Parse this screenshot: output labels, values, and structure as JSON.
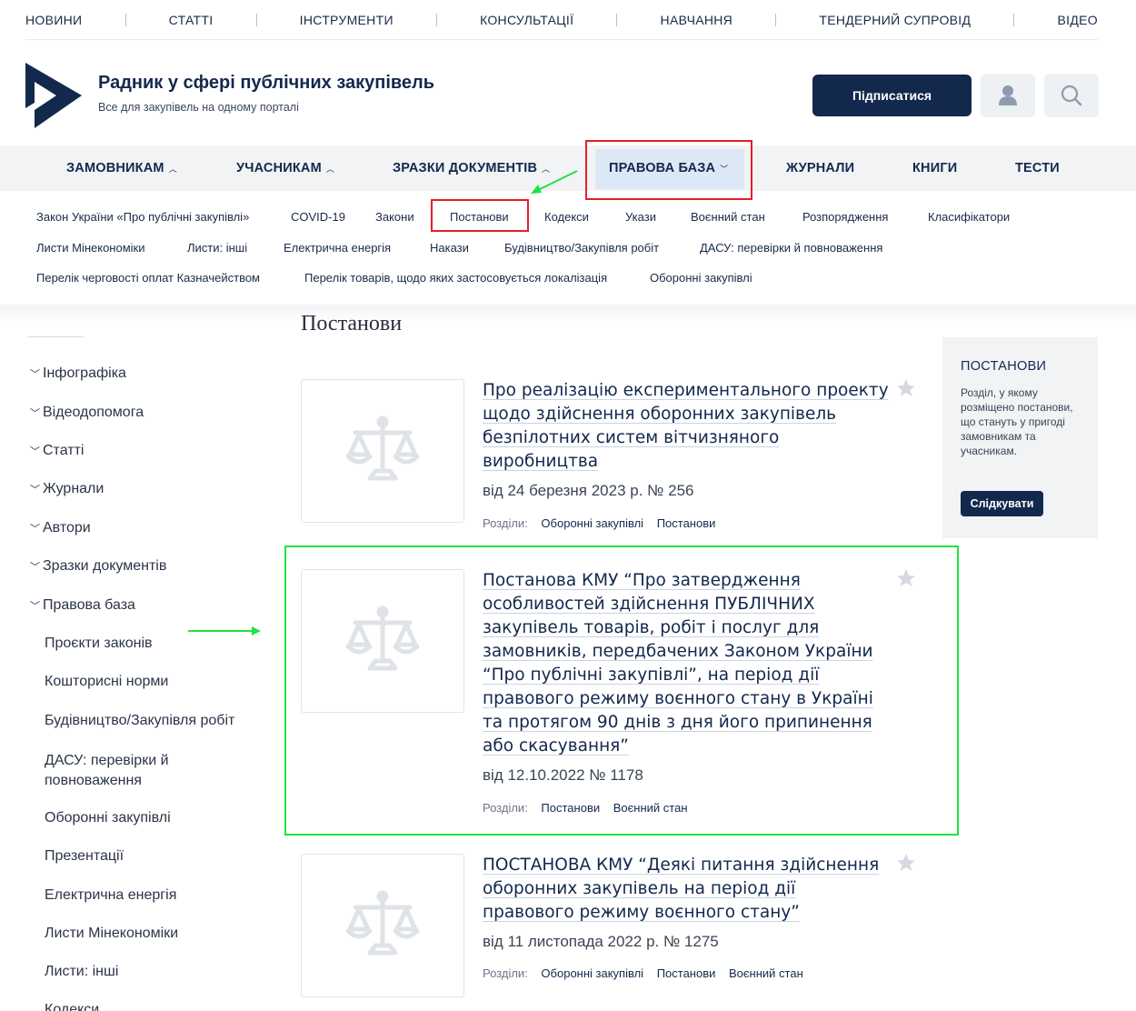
{
  "topnav": [
    "НОВИНИ",
    "СТАТТІ",
    "ІНСТРУМЕНТИ",
    "КОНСУЛЬТАЦІЇ",
    "НАВЧАННЯ",
    "ТЕНДЕРНИЙ СУПРОВІД",
    "ВІДЕО"
  ],
  "header": {
    "title": "Радник у сфері публічних закупівель",
    "subtitle": "Все для закупівель на одному порталі",
    "subscribe_label": "Підписатися",
    "user_icon": "user-icon",
    "search_icon": "search-icon"
  },
  "mainnav": {
    "items": [
      "ЗАМОВНИКАМ",
      "УЧАСНИКАМ",
      "ЗРАЗКИ ДОКУМЕНТІВ",
      "ПРАВОВА БАЗА",
      "ЖУРНАЛИ",
      "КНИГИ",
      "ТЕСТИ"
    ],
    "caret_up": "^",
    "caret_down": "v"
  },
  "subnav": {
    "items": [
      "Закон України «Про публічні закупівлі»",
      "COVID-19",
      "Закони",
      "Постанови",
      "Кодекси",
      "Укази",
      "Воєнний стан",
      "Розпорядження",
      "Класифікатори",
      "Листи Мінекономіки",
      "Листи: інші",
      "Електрична енергія",
      "Накази",
      "Будівництво/Закупівля робіт",
      "ДАСУ: перевірки й повноваження",
      "Перелік черговості оплат Казначейством",
      "Перелік товарів, щодо яких застосовується локалізація",
      "Оборонні закупівлі"
    ]
  },
  "sidebar": {
    "items": [
      "Інфографіка",
      "Відеодопомога",
      "Статті",
      "Журнали",
      "Автори",
      "Зразки документів",
      "Правова база"
    ],
    "subitems": [
      "Проєкти законів",
      "Кошторисні норми",
      "Будівництво/Закупівля робіт",
      "ДАСУ: перевірки й повноваження",
      "Оборонні закупівлі",
      "Презентації",
      "Електрична енергія",
      "Листи Мінекономіки",
      "Листи: інші",
      "Кодекси"
    ]
  },
  "page": {
    "title": "Постанови"
  },
  "articles": [
    {
      "title": "Про реалізацію експериментального проекту щодо здійснення оборонних закупівель безпілотних систем вітчизняного виробництва",
      "date": "від 24 березня 2023 р. № 256",
      "tags_label": "Розділи:",
      "tags": [
        "Оборонні закупівлі",
        "Постанови"
      ]
    },
    {
      "title": "Постанова КМУ “Про затвердження особливостей здійснення ПУБЛІЧНИХ закупівель товарів, робіт і послуг для замовників, передбачених Законом України “Про публічні закупівлі”, на період дії правового режиму воєнного стану в Україні та протягом 90 днів з дня його припинення або скасування”",
      "date": "від 12.10.2022 № 1178",
      "tags_label": "Розділи:",
      "tags": [
        "Постанови",
        "Воєнний стан"
      ]
    },
    {
      "title": "ПОСТАНОВА КМУ “Деякі питання здійснення оборонних закупівель на період дії правового режиму воєнного стану”",
      "date": "від 11 листопада 2022 р. № 1275",
      "tags_label": "Розділи:",
      "tags": [
        "Оборонні закупівлі",
        "Постанови",
        "Воєнний стан"
      ]
    }
  ],
  "rightbox": {
    "heading": "ПОСТАНОВИ",
    "description": "Розділ, у якому розміщено постанови, що стануть у пригоді замовникам та учасникам.",
    "follow_label": "Слідкувати"
  },
  "colors": {
    "brand": "#13284d",
    "annotation_red": "#e51f25",
    "annotation_green": "#22e243",
    "nav_bg": "#f1f3f5"
  }
}
